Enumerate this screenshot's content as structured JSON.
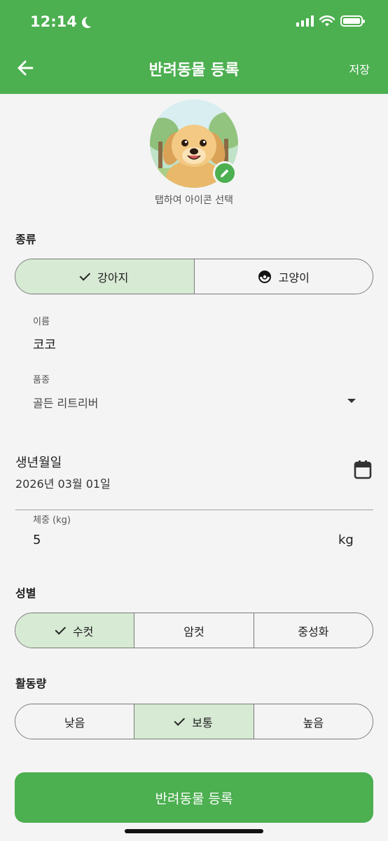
{
  "status_bar": {
    "time": "12:14"
  },
  "appbar": {
    "title": "반려동물 등록",
    "save_label": "저장"
  },
  "avatar": {
    "hint": "탭하여 아이콘 선택"
  },
  "species": {
    "label": "종류",
    "options": [
      {
        "label": "강아지",
        "selected": true
      },
      {
        "label": "고양이",
        "selected": false
      }
    ]
  },
  "name_field": {
    "label": "이름",
    "value": "코코"
  },
  "breed_field": {
    "label": "품종",
    "value": "골든 리트리버"
  },
  "birth_field": {
    "label": "생년월일",
    "value": "2026년 03월 01일"
  },
  "weight_field": {
    "label": "체중 (kg)",
    "value": "5",
    "unit": "kg"
  },
  "gender": {
    "label": "성별",
    "options": [
      {
        "label": "수컷",
        "selected": true
      },
      {
        "label": "암컷",
        "selected": false
      },
      {
        "label": "중성화",
        "selected": false
      }
    ]
  },
  "activity": {
    "label": "활동량",
    "options": [
      {
        "label": "낮음",
        "selected": false
      },
      {
        "label": "보통",
        "selected": true
      },
      {
        "label": "높음",
        "selected": false
      }
    ]
  },
  "submit_label": "반려동물 등록",
  "colors": {
    "primary": "#4caf50",
    "selected_segment": "#d7ead4",
    "background": "#f4f4f4"
  }
}
